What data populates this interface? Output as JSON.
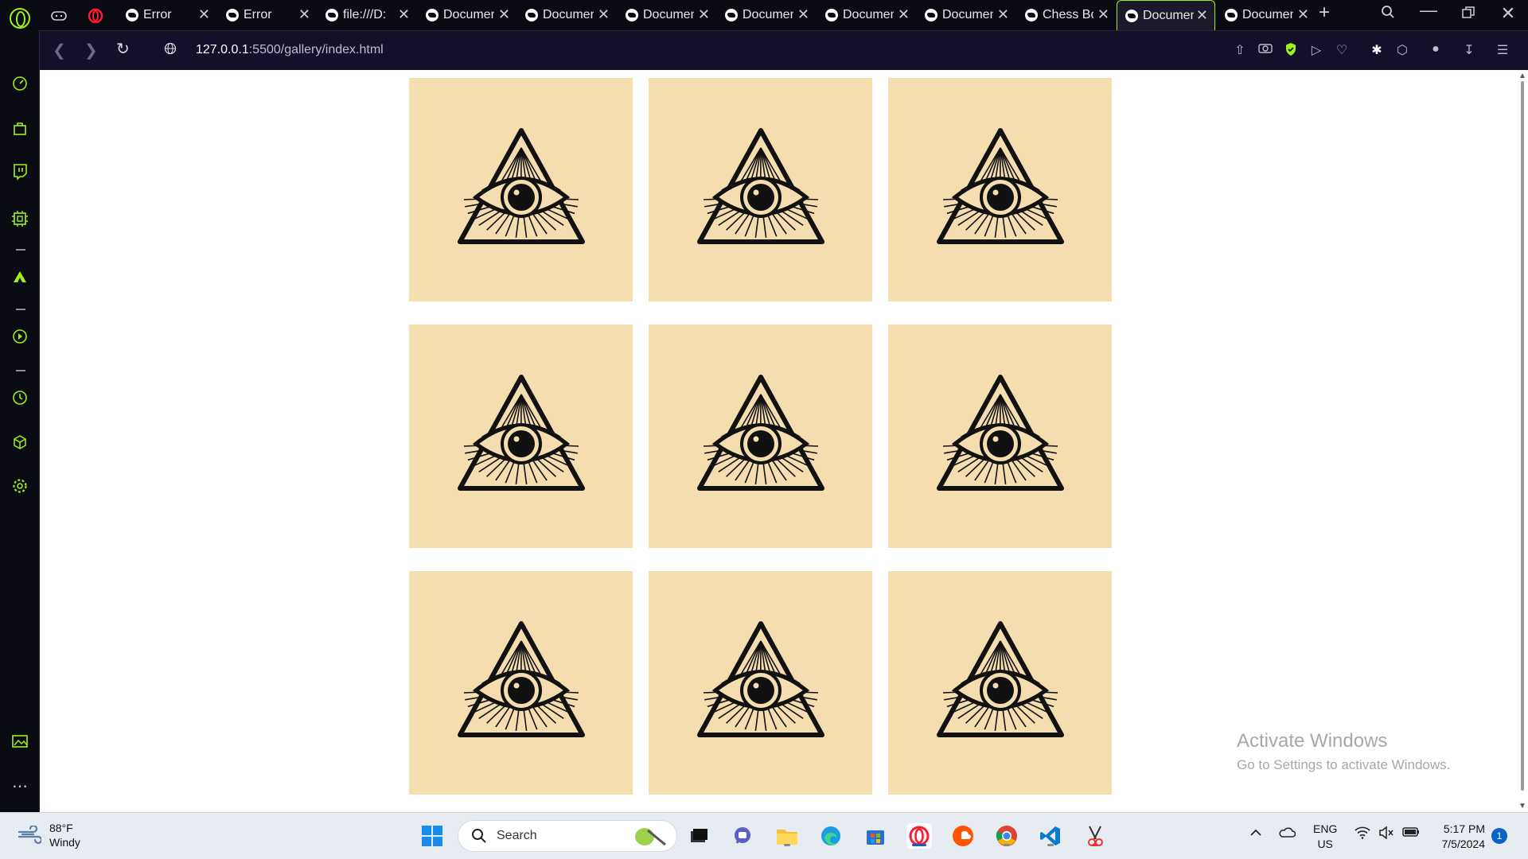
{
  "browser": {
    "tabs": [
      {
        "label": "Error",
        "active": false
      },
      {
        "label": "Error",
        "active": false
      },
      {
        "label": "file:///D:",
        "active": false
      },
      {
        "label": "Document",
        "active": false
      },
      {
        "label": "Document",
        "active": false
      },
      {
        "label": "Document",
        "active": false
      },
      {
        "label": "Document",
        "active": false
      },
      {
        "label": "Document",
        "active": false
      },
      {
        "label": "Document",
        "active": false
      },
      {
        "label": "Chess Bo",
        "active": false
      },
      {
        "label": "Document",
        "active": true
      },
      {
        "label": "Document",
        "active": false
      }
    ],
    "new_tab_label": "+",
    "address": {
      "host": "127.0.0.1",
      "path": ":5500/gallery/index.html"
    },
    "accent": "#9ef01a"
  },
  "gallery": {
    "tile_count": 9,
    "tile_background": "#f4deb0",
    "tile_icon": "eye-of-providence-icon"
  },
  "watermark": {
    "title": "Activate Windows",
    "subtitle": "Go to Settings to activate Windows."
  },
  "taskbar": {
    "weather": {
      "temp": "88°F",
      "condition": "Windy"
    },
    "search_placeholder": "Search",
    "language": {
      "line1": "ENG",
      "line2": "US"
    },
    "time": "5:17 PM",
    "date": "7/5/2024",
    "notification_count": "1"
  }
}
